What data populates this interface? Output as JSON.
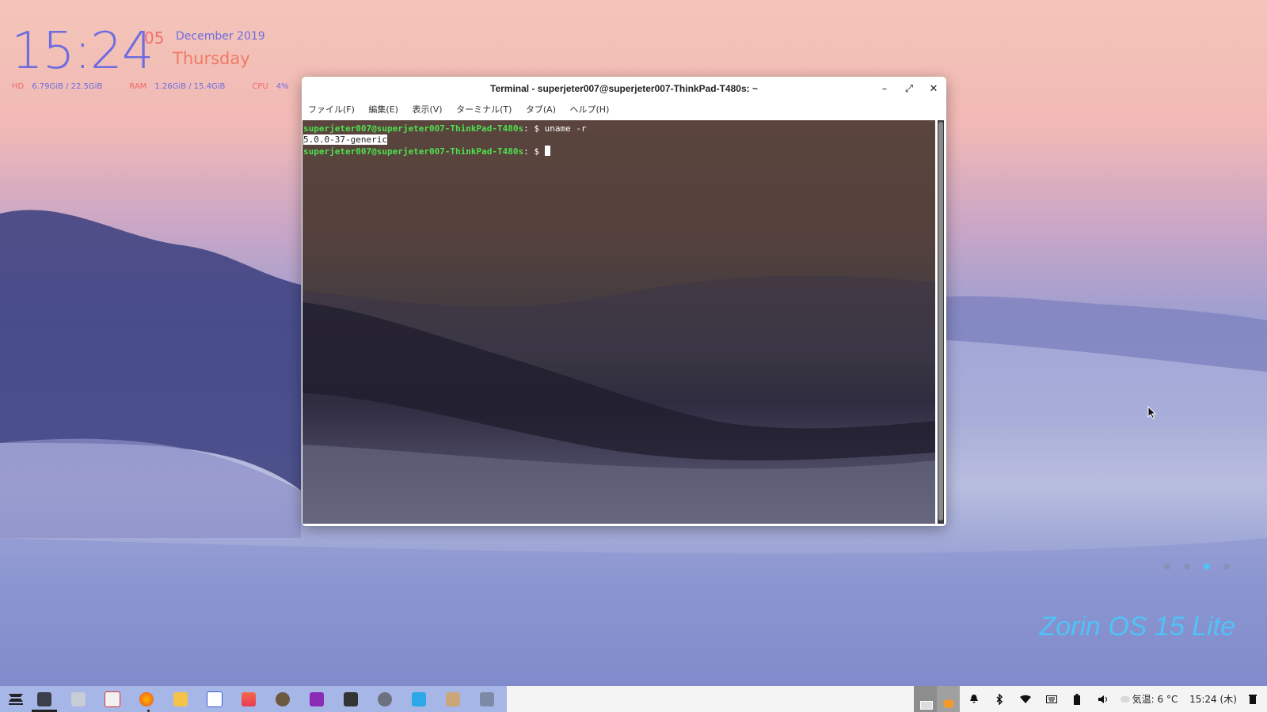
{
  "desktop": {
    "clock": {
      "time": "15:24",
      "seconds": "05",
      "date": "December 2019",
      "day": "Thursday"
    },
    "sysinfo": {
      "hd_label": "HD",
      "hd_value": "6.79GiB / 22.5GiB",
      "ram_label": "RAM",
      "ram_value": "1.26GiB / 15.4GiB",
      "cpu_label": "CPU",
      "cpu_value": "4%"
    },
    "brand": "Zorin OS 15 Lite",
    "page_dots": {
      "count": 4,
      "active_index": 2
    }
  },
  "terminal": {
    "title": "Terminal - superjeter007@superjeter007-ThinkPad-T480s: ~",
    "controls": {
      "minimize": "–",
      "maximize": "⤢",
      "close": "✕"
    },
    "menu": [
      "ファイル(F)",
      "編集(E)",
      "表示(V)",
      "ターミナル(T)",
      "タブ(A)",
      "ヘルプ(H)"
    ],
    "lines": {
      "prompt1": "superjeter007@superjeter007-ThinkPad-T480s",
      "sep1": ": $ ",
      "cmd1": "uname -r",
      "output1": "5.0.0-37-generic",
      "prompt2": "superjeter007@superjeter007-ThinkPad-T480s",
      "sep2": ": $ "
    }
  },
  "taskbar": {
    "apps": [
      "zorin-menu-icon",
      "terminal-icon",
      "files-icon",
      "document-viewer-icon",
      "firefox-icon",
      "mail-icon",
      "text-document-icon",
      "image-viewer-icon",
      "gimp-icon",
      "media-player-icon",
      "video-editor-icon",
      "settings-icon",
      "screenshot-icon",
      "archive-icon",
      "window-icon"
    ],
    "tray": {
      "weather": "気温: 6 °C",
      "clock": "15:24 (木)"
    },
    "colors": {
      "accent": "#6d6ce0",
      "brand": "#4fc3f7"
    }
  }
}
